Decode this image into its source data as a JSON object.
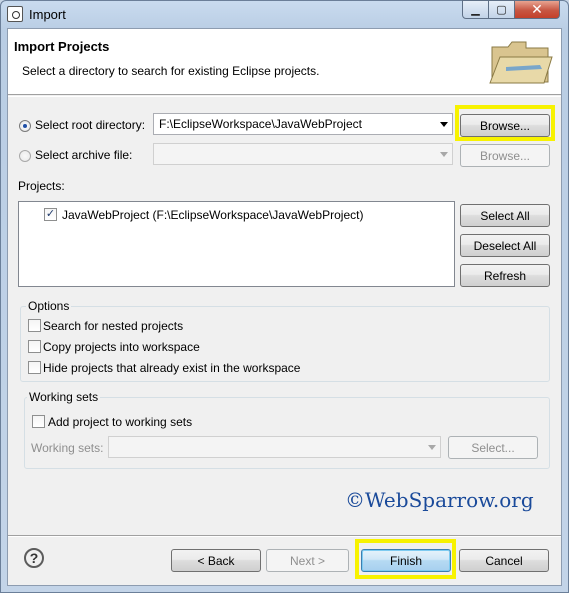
{
  "window": {
    "title": "Import"
  },
  "banner": {
    "title": "Import Projects",
    "subtitle": "Select a directory to search for existing Eclipse projects."
  },
  "source": {
    "root_label": "Select root directory:",
    "root_value": "F:\\EclipseWorkspace\\JavaWebProject",
    "archive_label": "Select archive file:",
    "archive_value": "",
    "browse_label": "Browse...",
    "browse_archive_label": "Browse..."
  },
  "projects": {
    "label": "Projects:",
    "items": [
      {
        "label": "JavaWebProject (F:\\EclipseWorkspace\\JavaWebProject)",
        "checked": true
      }
    ],
    "select_all": "Select All",
    "deselect_all": "Deselect All",
    "refresh": "Refresh"
  },
  "options": {
    "label": "Options",
    "nested": "Search for nested projects",
    "copy": "Copy projects into workspace",
    "hide": "Hide projects that already exist in the workspace"
  },
  "working_sets": {
    "label": "Working sets",
    "add": "Add project to working sets",
    "field_label": "Working sets:",
    "field_value": "",
    "select_label": "Select..."
  },
  "watermark": "©WebSparrow.org",
  "footer": {
    "help": "?",
    "back": "< Back",
    "next": "Next >",
    "finish": "Finish",
    "cancel": "Cancel"
  },
  "colors": {
    "highlight": "#f7f200",
    "accent": "#3c7fb1"
  }
}
